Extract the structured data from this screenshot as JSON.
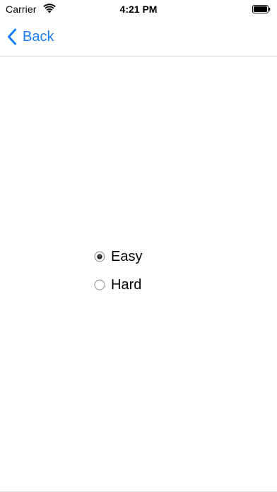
{
  "status_bar": {
    "carrier": "Carrier",
    "time": "4:21 PM",
    "wifi_icon": "wifi-icon",
    "battery_icon": "battery-full-icon"
  },
  "nav": {
    "back_label": "Back",
    "back_icon": "chevron-left-icon",
    "accent_color": "#1a7cf5"
  },
  "difficulty": {
    "options": [
      {
        "label": "Easy",
        "selected": true
      },
      {
        "label": "Hard",
        "selected": false
      }
    ]
  }
}
